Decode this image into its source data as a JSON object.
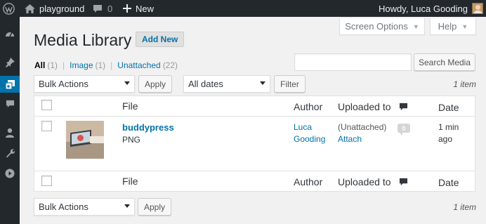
{
  "adminbar": {
    "site_name": "playground",
    "comments_count": "0",
    "new_label": "New",
    "greeting": "Howdy, Luca Gooding"
  },
  "screen_options": {
    "label": "Screen Options"
  },
  "help": {
    "label": "Help"
  },
  "page": {
    "title": "Media Library",
    "add_new_label": "Add New"
  },
  "filters": [
    {
      "label": "All",
      "count": "(1)"
    },
    {
      "label": "Image",
      "count": "(1)"
    },
    {
      "label": "Unattached",
      "count": "(22)"
    }
  ],
  "search": {
    "value": "",
    "button_label": "Search Media"
  },
  "top_nav": {
    "bulk_actions": "Bulk Actions",
    "apply_label": "Apply",
    "dates": "All dates",
    "filter_label": "Filter",
    "items_count": "1 item"
  },
  "table": {
    "columns": {
      "file": "File",
      "author": "Author",
      "uploaded_to": "Uploaded to",
      "date": "Date"
    },
    "rows": [
      {
        "title": "buddypress",
        "type": "PNG",
        "author_line1": "Luca",
        "author_line2": "Gooding",
        "uploaded_status": "(Unattached)",
        "attach_label": "Attach",
        "comments": "0",
        "date_line1": "1 min",
        "date_line2": "ago"
      }
    ]
  },
  "bottom_nav": {
    "bulk_actions": "Bulk Actions",
    "apply_label": "Apply",
    "items_count": "1 item"
  },
  "colors": {
    "admin_bar": "#23282d",
    "accent": "#0073aa",
    "background": "#f1f1f1"
  }
}
